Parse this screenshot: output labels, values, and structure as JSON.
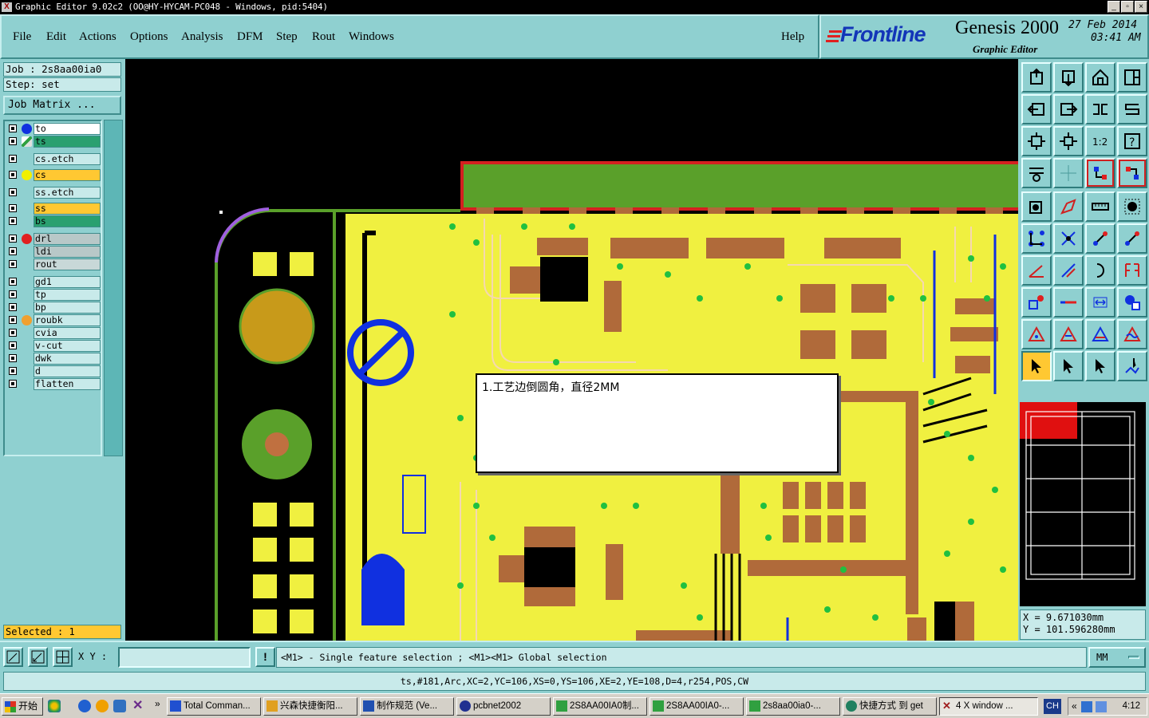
{
  "window": {
    "title": "Graphic Editor 9.02c2  (OO@HY-HYCAM-PC048 - Windows, pid:5404)",
    "app_icon": "X",
    "controls": [
      "_",
      "▫",
      "×"
    ]
  },
  "menu": {
    "items": [
      "File",
      "Edit",
      "Actions",
      "Options",
      "Analysis",
      "DFM",
      "Step",
      "Rout",
      "Windows"
    ],
    "help": "Help"
  },
  "brand": {
    "logo": "Frontline",
    "product": "Genesis 2000",
    "subtitle": "Graphic Editor",
    "date": "27 Feb 2014",
    "time": "03:41 AM",
    "logo_color": "#1235b8"
  },
  "job": {
    "job_line": "Job : 2s8aa00ia0",
    "step_line": "Step: set",
    "matrix_button": "Job Matrix ..."
  },
  "layers": [
    {
      "name": "to",
      "color": "#ffffff",
      "dot": "#1030e0"
    },
    {
      "name": "ts",
      "color": "#2aa070",
      "dot": "edit-icon"
    },
    {
      "name": "cs.etch",
      "color": "#c8eaea",
      "dot": ""
    },
    {
      "name": "cs",
      "color": "#ffc832",
      "dot": "#f0f000"
    },
    {
      "name": "ss.etch",
      "color": "#c8eaea",
      "dot": ""
    },
    {
      "name": "ss",
      "color": "#ffc832",
      "dot": ""
    },
    {
      "name": "bs",
      "color": "#2aa070",
      "dot": ""
    },
    {
      "name": "drl",
      "color": "#b8c8c8",
      "dot": "#e02020"
    },
    {
      "name": "ldi",
      "color": "#b8c8c8",
      "dot": ""
    },
    {
      "name": "rout",
      "color": "#c8d8d8",
      "dot": ""
    },
    {
      "name": "gd1",
      "color": "#c8eaea",
      "dot": ""
    },
    {
      "name": "tp",
      "color": "#c8eaea",
      "dot": ""
    },
    {
      "name": "bp",
      "color": "#c8eaea",
      "dot": ""
    },
    {
      "name": "roubk",
      "color": "#c8eaea",
      "dot": "#f0a030"
    },
    {
      "name": "cvia",
      "color": "#c8eaea",
      "dot": ""
    },
    {
      "name": "v-cut",
      "color": "#c8eaea",
      "dot": ""
    },
    {
      "name": "dwk",
      "color": "#c8eaea",
      "dot": ""
    },
    {
      "name": "d",
      "color": "#c8eaea",
      "dot": ""
    },
    {
      "name": "flatten",
      "color": "#c8eaea",
      "dot": ""
    }
  ],
  "selection": {
    "status": "Selected : 1"
  },
  "note": {
    "text": "1.工艺边倒圆角，直径2MM"
  },
  "coords": {
    "x_line": "X  =  9.671030mm",
    "y_line": "Y  = 101.596280mm"
  },
  "command": {
    "xy_label": "X Y :",
    "xy_value": "",
    "alert": "!",
    "mouse_hint": "<M1> - Single feature selection ; <M1><M1> Global selection",
    "units": "MM"
  },
  "feature_info": "ts,#181,Arc,XC=2,YC=106,XS=0,YS=106,XE=2,YE=108,D=4,r254,POS,CW",
  "taskbar": {
    "start": "开始",
    "more": "»",
    "tasks": [
      {
        "label": "Total Comman...",
        "icon": "#2050d0"
      },
      {
        "label": "兴森快捷衡阳...",
        "icon": "#e0a020"
      },
      {
        "label": "制作规范 (Ve...",
        "icon": "#2050b0"
      },
      {
        "label": "pcbnet2002",
        "icon": "#203090"
      },
      {
        "label": "2S8AA00IA0制...",
        "icon": "#30a040"
      },
      {
        "label": "2S8AA00IA0-...",
        "icon": "#30a040"
      },
      {
        "label": "2s8aa00ia0-...",
        "icon": "#30a040"
      },
      {
        "label": "快捷方式 到 get",
        "icon": "#208060"
      },
      {
        "label": "4 X window ...",
        "icon": "#a02020"
      }
    ],
    "lang": "CH",
    "tray_more": "«",
    "clock": "4:12"
  }
}
